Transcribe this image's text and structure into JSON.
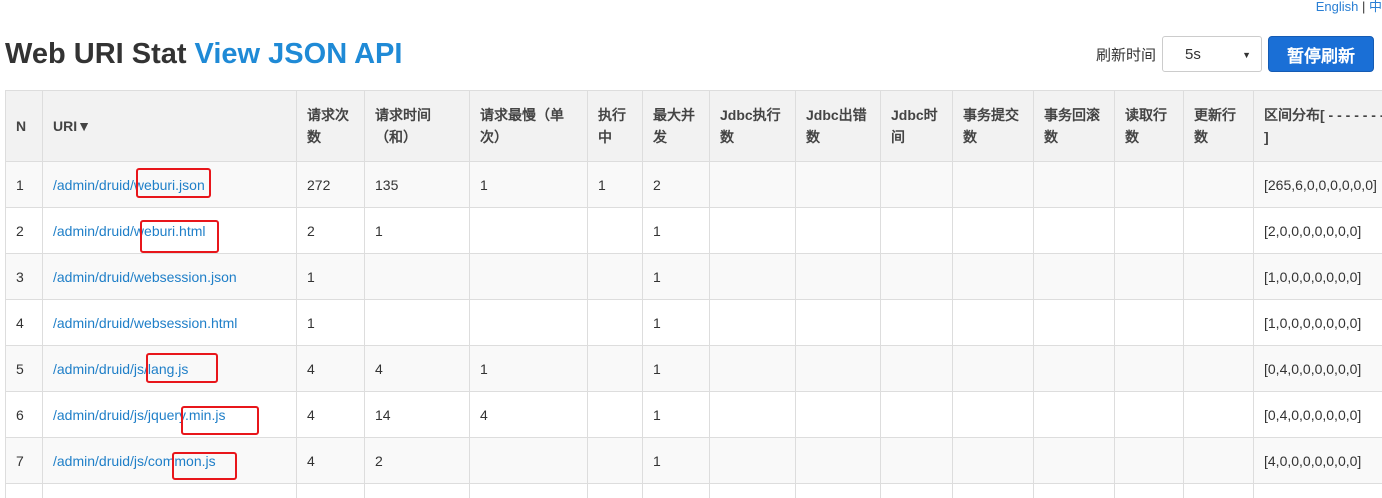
{
  "header": {
    "lang_english": "English",
    "lang_sep": " | ",
    "lang_chinese": "中",
    "title": "Web URI Stat",
    "api_link": "View JSON API"
  },
  "controls": {
    "refresh_label": "刷新时间",
    "interval_selected": "5s",
    "pause_button": "暂停刷新"
  },
  "table": {
    "columns": [
      "N",
      "URI▼",
      "请求次数",
      "请求时间（和）",
      "请求最慢（单次）",
      "执行中",
      "最大并发",
      "Jdbc执行数",
      "Jdbc出错数",
      "Jdbc时间",
      "事务提交数",
      "事务回滚数",
      "读取行数",
      "更新行数",
      "区间分布[ - - - - - - - - ]"
    ],
    "rows": [
      [
        "1",
        "/admin/druid/weburi.json",
        "272",
        "135",
        "1",
        "1",
        "2",
        "",
        "",
        "",
        "",
        "",
        "",
        "",
        "[265,6,0,0,0,0,0,0]"
      ],
      [
        "2",
        "/admin/druid/weburi.html",
        "2",
        "1",
        "",
        "",
        "1",
        "",
        "",
        "",
        "",
        "",
        "",
        "",
        "[2,0,0,0,0,0,0,0]"
      ],
      [
        "3",
        "/admin/druid/websession.json",
        "1",
        "",
        "",
        "",
        "1",
        "",
        "",
        "",
        "",
        "",
        "",
        "",
        "[1,0,0,0,0,0,0,0]"
      ],
      [
        "4",
        "/admin/druid/websession.html",
        "1",
        "",
        "",
        "",
        "1",
        "",
        "",
        "",
        "",
        "",
        "",
        "",
        "[1,0,0,0,0,0,0,0]"
      ],
      [
        "5",
        "/admin/druid/js/lang.js",
        "4",
        "4",
        "1",
        "",
        "1",
        "",
        "",
        "",
        "",
        "",
        "",
        "",
        "[0,4,0,0,0,0,0,0]"
      ],
      [
        "6",
        "/admin/druid/js/jquery.min.js",
        "4",
        "14",
        "4",
        "",
        "1",
        "",
        "",
        "",
        "",
        "",
        "",
        "",
        "[0,4,0,0,0,0,0,0]"
      ],
      [
        "7",
        "/admin/druid/js/common.js",
        "4",
        "2",
        "",
        "",
        "1",
        "",
        "",
        "",
        "",
        "",
        "",
        "",
        "[4,0,0,0,0,0,0,0]"
      ]
    ]
  },
  "colors": {
    "link": "#1f7fc8",
    "button": "#1a6fd6",
    "annotation": "#e8161b"
  }
}
